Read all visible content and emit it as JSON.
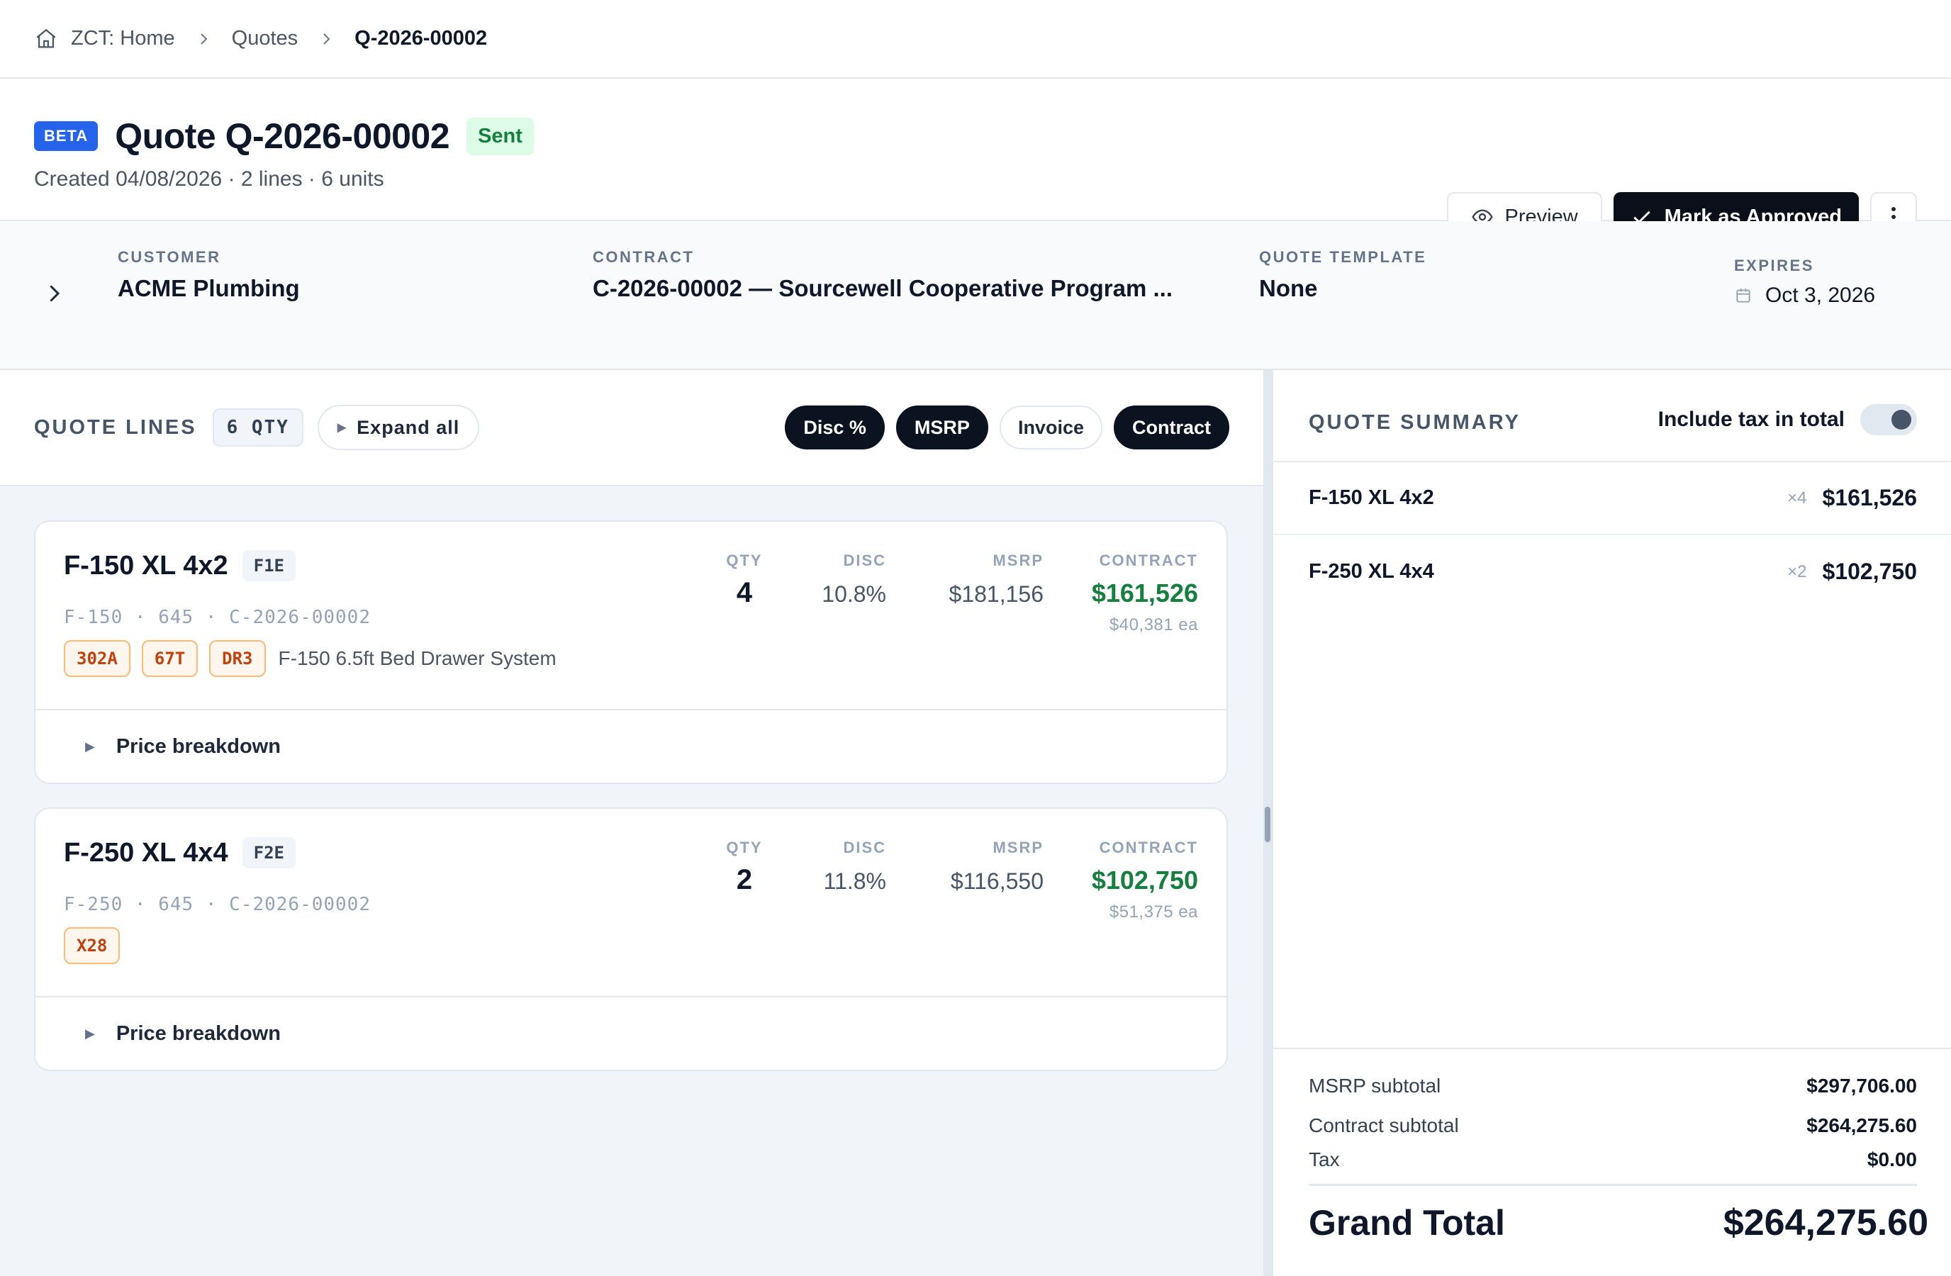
{
  "breadcrumb": {
    "home": "ZCT: Home",
    "quotes": "Quotes",
    "current": "Q-2026-00002"
  },
  "header": {
    "beta": "BETA",
    "title": "Quote Q-2026-00002",
    "status": "Sent",
    "subtitle": "Created 04/08/2026 · 2 lines · 6 units",
    "preview_label": "Preview",
    "approve_label": "Mark as Approved"
  },
  "meta": {
    "customer": {
      "label": "CUSTOMER",
      "value": "ACME Plumbing"
    },
    "contract": {
      "label": "CONTRACT",
      "value": "C-2026-00002 — Sourcewell Cooperative Program ..."
    },
    "template": {
      "label": "QUOTE TEMPLATE",
      "value": "None"
    },
    "expires": {
      "label": "EXPIRES",
      "value": "Oct 3, 2026"
    }
  },
  "lines_panel": {
    "title": "QUOTE LINES",
    "qty_pill": "6 QTY",
    "expand_all": "Expand all",
    "toggles": [
      "Disc %",
      "MSRP",
      "Invoice",
      "Contract"
    ],
    "col_labels": {
      "qty": "QTY",
      "disc": "DISC",
      "msrp": "MSRP",
      "contract": "CONTRACT"
    },
    "price_breakdown": "Price breakdown",
    "lines": [
      {
        "name": "F-150 XL 4x2",
        "code": "F1E",
        "sub": "F-150 · 645 · C-2026-00002",
        "options": [
          "302A",
          "67T",
          "DR3"
        ],
        "option_desc": "F-150 6.5ft Bed Drawer System",
        "qty": "4",
        "disc": "10.8%",
        "msrp": "$181,156",
        "contract": "$161,526",
        "each": "$40,381 ea"
      },
      {
        "name": "F-250 XL 4x4",
        "code": "F2E",
        "sub": "F-250 · 645 · C-2026-00002",
        "options": [
          "X28"
        ],
        "option_desc": "",
        "qty": "2",
        "disc": "11.8%",
        "msrp": "$116,550",
        "contract": "$102,750",
        "each": "$51,375 ea"
      }
    ]
  },
  "summary": {
    "title": "QUOTE SUMMARY",
    "tax_toggle_label": "Include tax in total",
    "items": [
      {
        "name": "F-150 XL 4x2",
        "mult": "×4",
        "amount": "$161,526"
      },
      {
        "name": "F-250 XL 4x4",
        "mult": "×2",
        "amount": "$102,750"
      }
    ],
    "totals": {
      "msrp_label": "MSRP subtotal",
      "msrp_value": "$297,706.00",
      "contract_label": "Contract subtotal",
      "contract_value": "$264,275.60",
      "tax_label": "Tax",
      "tax_value": "$0.00",
      "grand_label": "Grand Total",
      "grand_value": "$264,275.60"
    }
  },
  "colors": {
    "beta_bg": "#2563eb",
    "sent_bg": "#dcfce7",
    "sent_fg": "#15803d",
    "primary_dark": "#0b0f19",
    "contract_green": "#15803d",
    "option_chip_fg": "#c2410c"
  }
}
